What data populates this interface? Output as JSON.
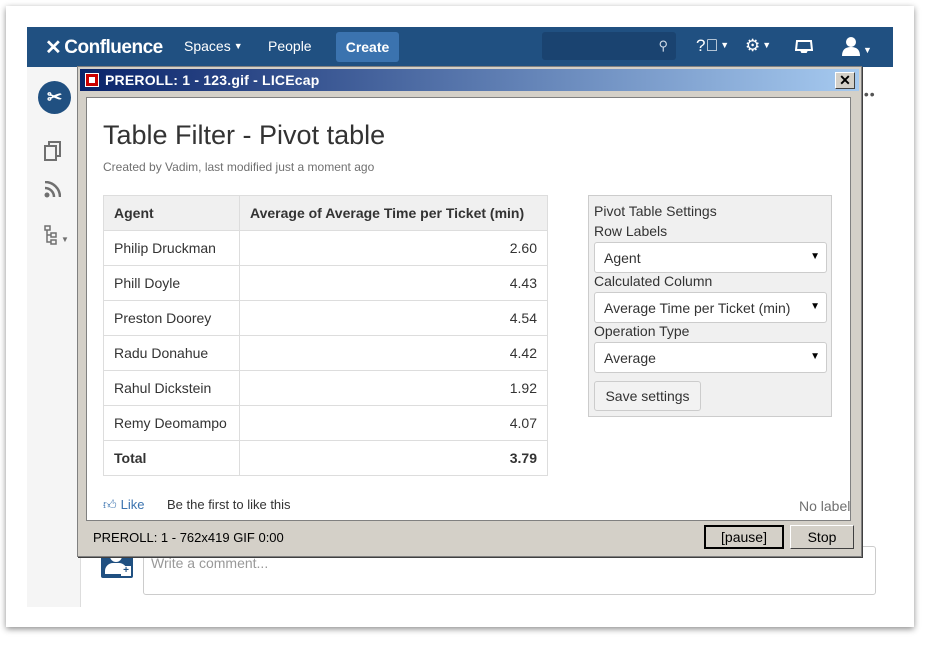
{
  "header": {
    "logo": "Confluence",
    "nav_spaces": "Spaces",
    "nav_people": "People",
    "create": "Create"
  },
  "comment": {
    "placeholder": "Write a comment..."
  },
  "licecap": {
    "title": "PREROLL: 1 - 123.gif - LICEcap",
    "close": "✕",
    "status": "PREROLL: 1 - 762x419 GIF 0:00",
    "pause": "[pause]",
    "stop": "Stop"
  },
  "page": {
    "title": "Table Filter - Pivot table",
    "byline": "Created by Vadim, last modified just a moment ago",
    "like": "Like",
    "first_like": "Be the first to like this",
    "no_labels": "No labels"
  },
  "pivot": {
    "headers": [
      "Agent",
      "Average of Average Time per Ticket (min)"
    ],
    "rows": [
      [
        "Philip Druckman",
        "2.60"
      ],
      [
        "Phill Doyle",
        "4.43"
      ],
      [
        "Preston Doorey",
        "4.54"
      ],
      [
        "Radu Donahue",
        "4.42"
      ],
      [
        "Rahul Dickstein",
        "1.92"
      ],
      [
        "Remy Deomampo",
        "4.07"
      ]
    ],
    "total": [
      "Total",
      "3.79"
    ]
  },
  "settings": {
    "title": "Pivot Table Settings",
    "row_labels": "Row Labels",
    "row_labels_value": "Agent",
    "calc_column": "Calculated Column",
    "calc_column_value": "Average Time per Ticket (min)",
    "op_type": "Operation Type",
    "op_type_value": "Average",
    "save": "Save settings"
  }
}
